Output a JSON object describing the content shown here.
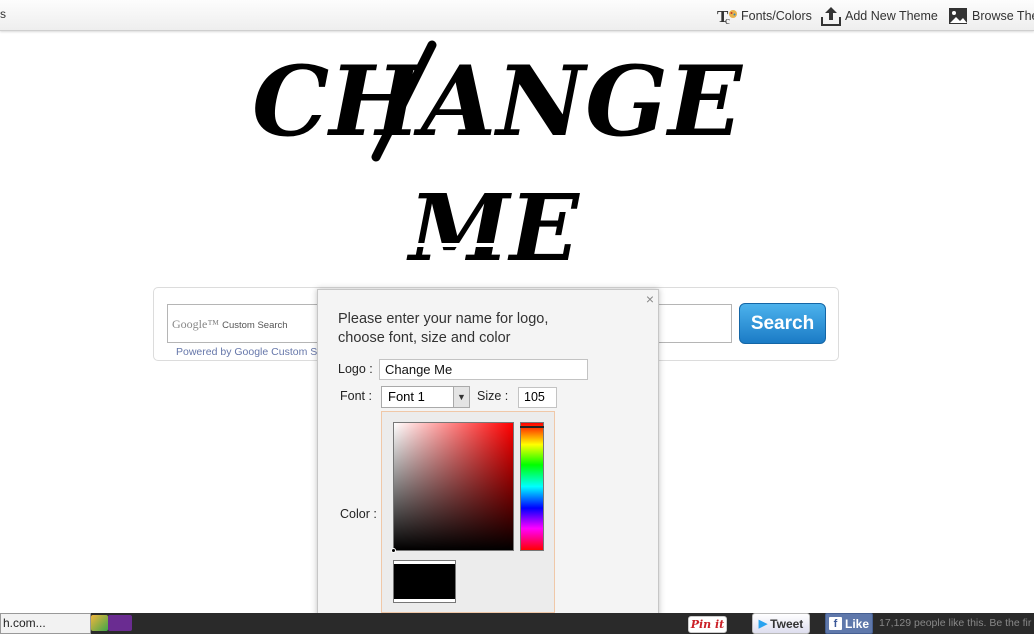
{
  "topbar": {
    "left_fragment": "s",
    "links": [
      {
        "label": "Fonts/Colors",
        "icon": "fonts-colors-icon"
      },
      {
        "label": "Add New Theme",
        "icon": "upload-icon"
      },
      {
        "label": "Browse The",
        "icon": "image-icon"
      }
    ]
  },
  "logo": {
    "line1": "CHANGE",
    "line2": "ME",
    "color": "#000000"
  },
  "search": {
    "google_brand": "Google™",
    "placeholder": "Custom Search",
    "powered_by": "Powered by Google Custom S",
    "button_label": "Search",
    "button_color": "#2a8fd8"
  },
  "dialog": {
    "close_symbol": "×",
    "prompt": "Please enter your name for logo, choose font, size and color",
    "logo_label": "Logo :",
    "logo_value": "Change Me",
    "font_label": "Font :",
    "font_value": "Font 1",
    "size_label": "Size :",
    "size_value": "105",
    "color_label": "Color :",
    "selected_color": "#000000",
    "hue_color": "#ff0000"
  },
  "bottom": {
    "tab_label": "h.com...",
    "pinit_label": "Pin it",
    "tweet_label": "Tweet",
    "like_label": "Like",
    "fb_icon": "f",
    "like_count_text": "17,129 people like this. Be the fir"
  }
}
